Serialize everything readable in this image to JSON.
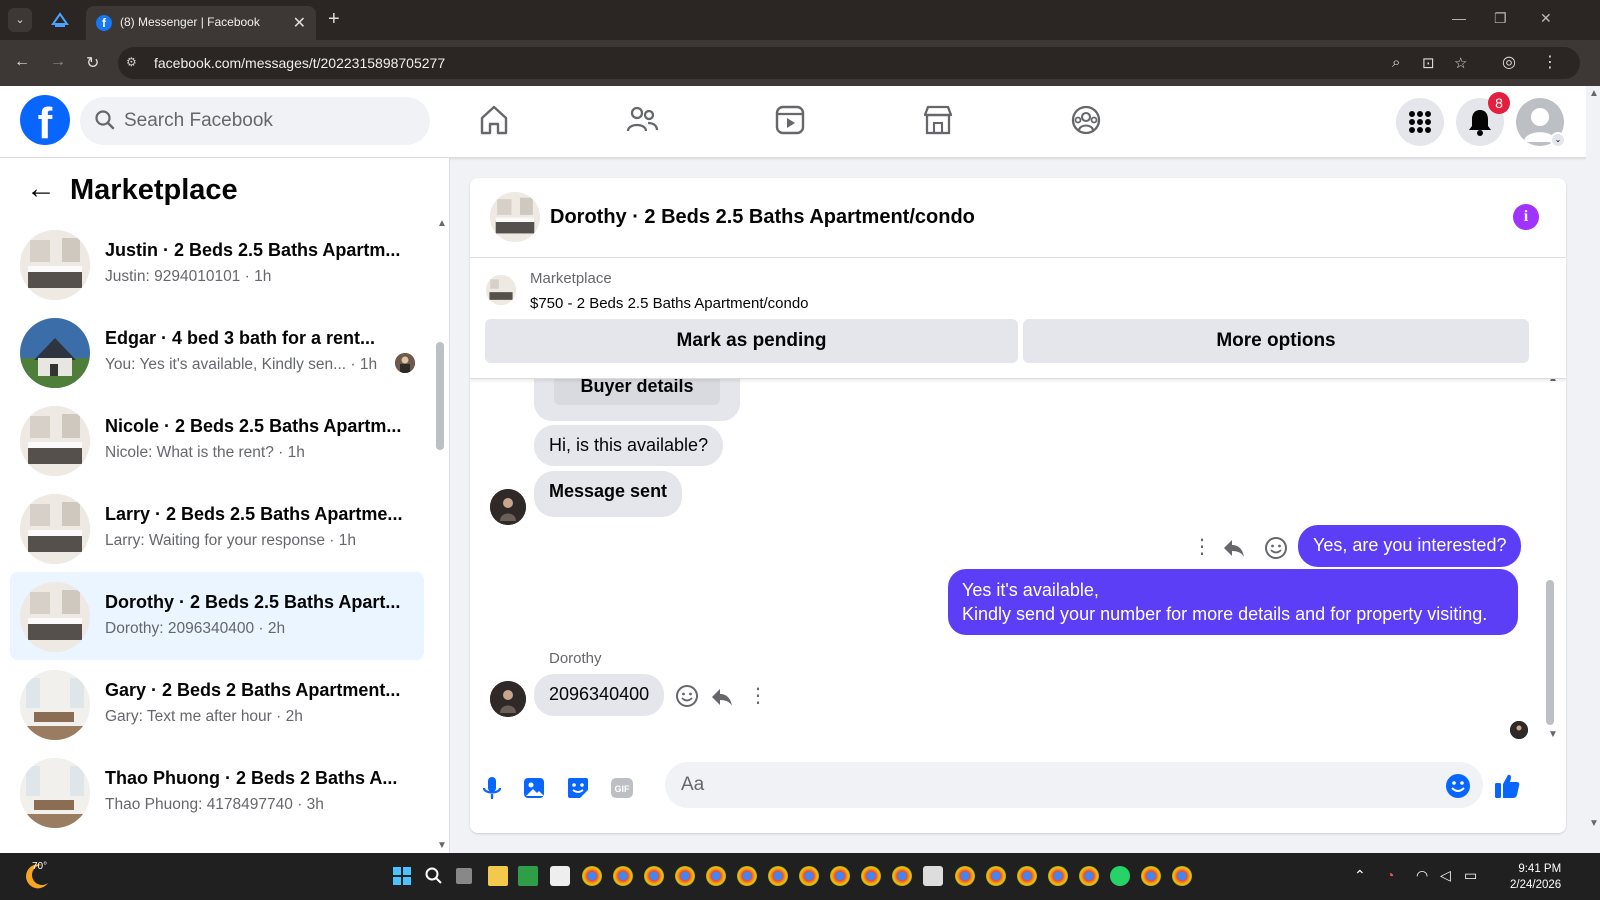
{
  "browser": {
    "tab_title": "(8) Messenger | Facebook",
    "url": "facebook.com/messages/t/2022315898705277"
  },
  "header": {
    "search_placeholder": "Search Facebook",
    "notification_count": "8",
    "nav_tabs": [
      "home-icon",
      "friends-icon",
      "video-icon",
      "marketplace-icon",
      "groups-icon"
    ]
  },
  "sidebar": {
    "title": "Marketplace",
    "conversations": [
      {
        "name": "Justin · 2 Beds 2.5 Baths Apartm...",
        "preview": "Justin: 9294010101 · 1h"
      },
      {
        "name": "Edgar · 4 bed 3 bath for a rent...",
        "preview": "You: Yes it's available, Kindly sen...   · 1h"
      },
      {
        "name": "Nicole · 2 Beds 2.5 Baths Apartm...",
        "preview": "Nicole: What is the rent? · 1h"
      },
      {
        "name": "Larry · 2 Beds 2.5 Baths Apartme...",
        "preview": "Larry: Waiting for your response · 1h"
      },
      {
        "name": "Dorothy · 2 Beds 2.5 Baths Apart...",
        "preview": "Dorothy: 2096340400 · 2h"
      },
      {
        "name": "Gary · 2 Beds 2 Baths Apartment...",
        "preview": "Gary: Text me after hour · 2h"
      },
      {
        "name": "Thao Phuong · 2 Beds 2 Baths A...",
        "preview": "Thao Phuong: 4178497740 · 3h"
      }
    ]
  },
  "chat": {
    "title": "Dorothy · 2 Beds 2.5 Baths Apartment/condo",
    "listing_label": "Marketplace",
    "listing_title": "$750 - 2 Beds 2.5 Baths Apartment/condo",
    "mark_pending": "Mark as pending",
    "more_options": "More options",
    "buyer_details": "Buyer details",
    "msg_available_q": "Hi, is this available?",
    "msg_sent": "Message sent",
    "msg_interested": "Yes, are you interested?",
    "msg_reply_line1": "Yes it's available,",
    "msg_reply_line2": "Kindly send your number for more details and for property visiting.",
    "sender": "Dorothy",
    "msg_number": "2096340400",
    "composer_placeholder": "Aa"
  },
  "taskbar": {
    "temperature": "70°",
    "time": "9:41 PM",
    "date": "2/24/2026"
  },
  "colors": {
    "fb_blue": "#0866ff",
    "outgoing_bubble": "#5b3ef5",
    "active_conv": "#ebf5ff",
    "badge": "#e41e3f"
  }
}
